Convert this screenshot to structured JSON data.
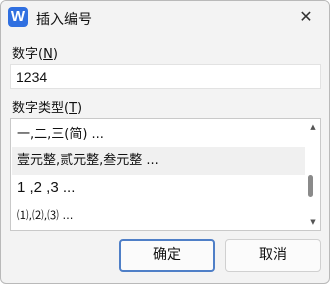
{
  "window": {
    "icon_letter": "W",
    "title": "插入编号",
    "close_glyph": "✕"
  },
  "number_field": {
    "label_prefix": "数字(",
    "label_hotkey": "N",
    "label_suffix": ")",
    "value": "1234"
  },
  "type_field": {
    "label_prefix": "数字类型(",
    "label_hotkey": "T",
    "label_suffix": ")",
    "items": [
      "一,二,三(简) ...",
      "壹元整,贰元整,叁元整 ...",
      "1 ,2 ,3  ...",
      "⑴,⑵,⑶ ..."
    ],
    "selected_index": 1
  },
  "buttons": {
    "ok": "确定",
    "cancel": "取消"
  },
  "colors": {
    "app_icon": "#2f6fe0",
    "primary_border": "#4f7fc7",
    "selected_row": "#f0f0f0"
  }
}
